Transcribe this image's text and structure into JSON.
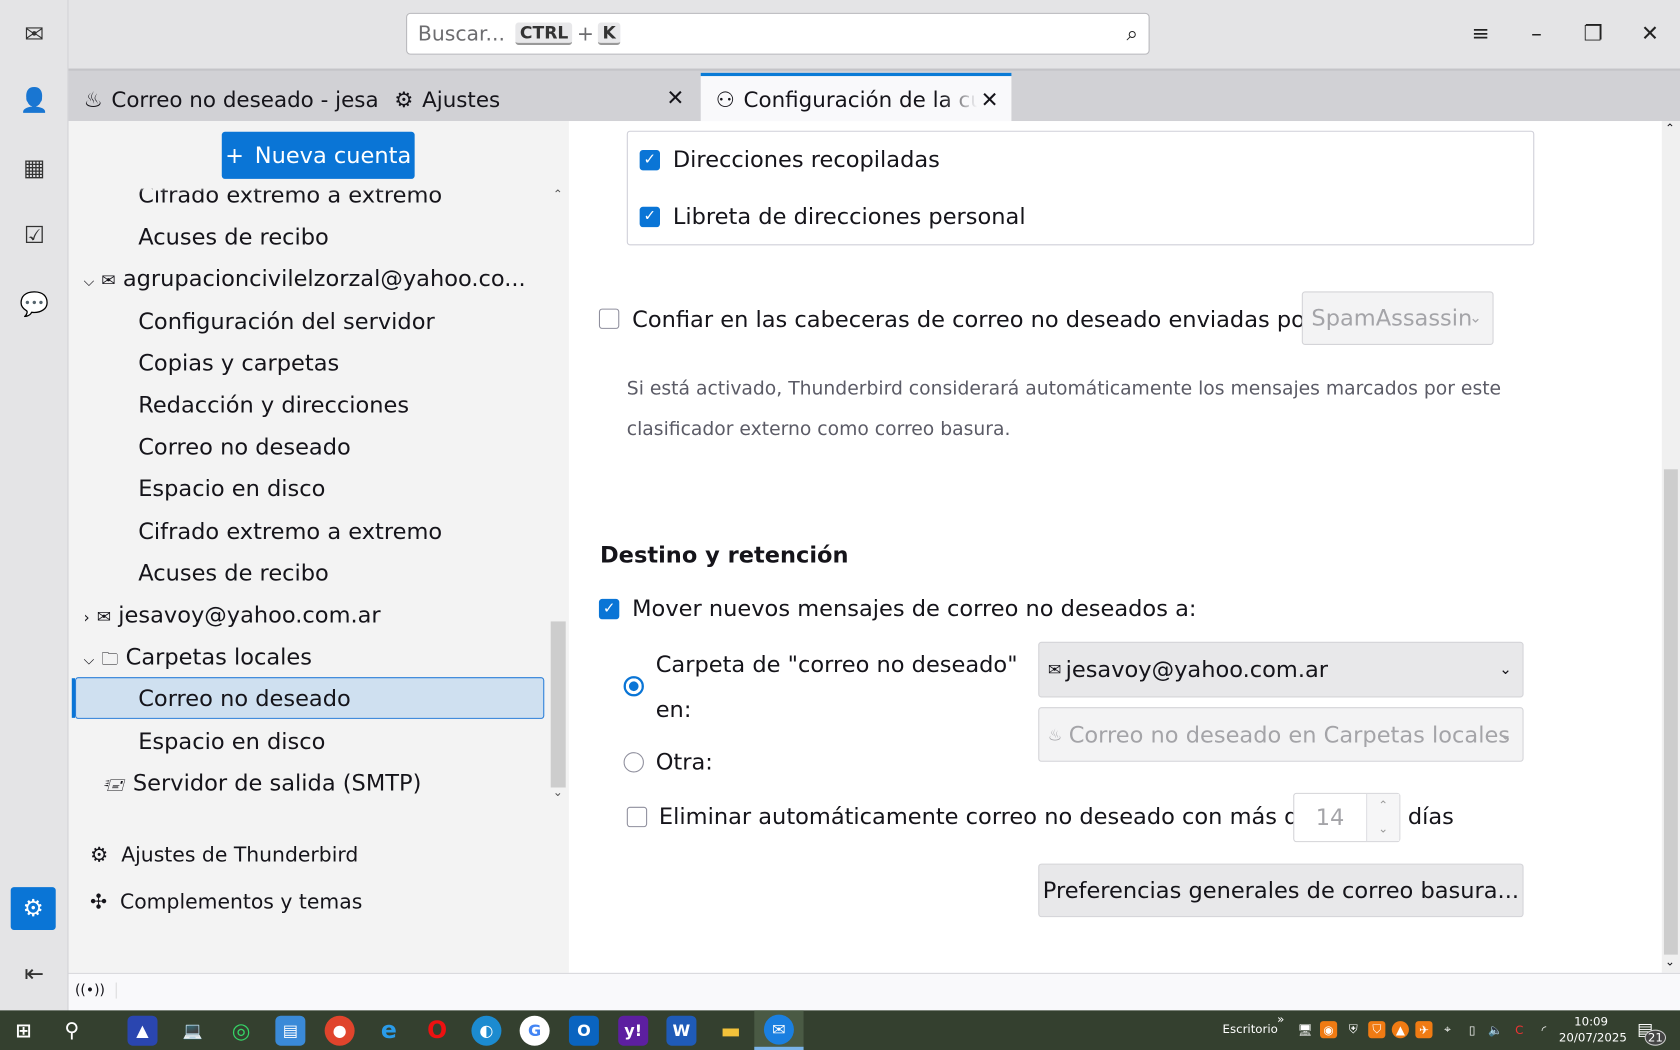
{
  "search": {
    "placeholder": "Buscar...",
    "key1": "CTRL",
    "plus": "+",
    "key2": "K"
  },
  "tabs": [
    {
      "label": "Correo no deseado - jesavoy@yahoo.com.ar"
    },
    {
      "label": "Ajustes"
    },
    {
      "label": "Configuración de la cuenta"
    }
  ],
  "sidebar": {
    "new_account": "Nueva cuenta",
    "items": [
      "Cifrado extremo a extremo",
      "Acuses de recibo",
      "agrupacioncivilelzorzal@yahoo.co...",
      "Configuración del servidor",
      "Copias y carpetas",
      "Redacción y direcciones",
      "Correo no deseado",
      "Espacio en disco",
      "Cifrado extremo a extremo",
      "Acuses de recibo",
      "jesavoy@yahoo.com.ar",
      "Carpetas locales",
      "Correo no deseado",
      "Espacio en disco",
      "Servidor de salida (SMTP)"
    ],
    "settings": "Ajustes de Thunderbird",
    "addons": "Complementos y temas"
  },
  "main": {
    "addr_collected": "Direcciones recopiladas",
    "addr_personal": "Libreta de direcciones personal",
    "trust_headers": "Confiar en las cabeceras de correo no deseado enviadas por:",
    "trust_select": "SpamAssassin",
    "trust_desc": "Si está activado, Thunderbird considerará automáticamente los mensajes marcados por este clasificador externo como correo basura.",
    "section_title": "Destino y retención",
    "move_label": "Mover nuevos mensajes de correo no deseados a:",
    "radio_folder": "Carpeta de \"correo no deseado\"",
    "radio_folder_en": "en:",
    "radio_other": "Otra:",
    "account_select": "jesavoy@yahoo.com.ar",
    "other_select": "Correo no deseado en Carpetas locales",
    "delete_label": "Eliminar automáticamente correo no deseado con más de",
    "delete_days": "14",
    "days_label": "días",
    "prefs_button": "Preferencias generales de correo basura..."
  },
  "taskbar": {
    "desktop": "Escritorio",
    "time": "10:09",
    "date": "20/07/2025",
    "notifications": "21"
  }
}
